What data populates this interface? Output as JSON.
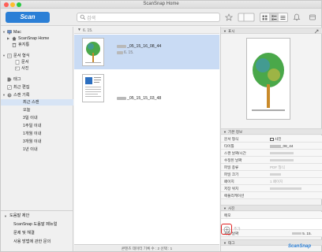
{
  "window": {
    "title": "ScanSnap Home"
  },
  "toolbar": {
    "scan_label": "Scan",
    "search_placeholder": "검색"
  },
  "sidebar": {
    "items": [
      {
        "label": "Mac",
        "level": 0,
        "icon": "computer-icon"
      },
      {
        "label": "ScanSnap Home",
        "level": 1,
        "icon": "home-icon"
      },
      {
        "label": "휴지통",
        "level": 1,
        "icon": "trash-icon"
      },
      {
        "label": "문서 형식",
        "level": 0,
        "icon": "document-type-icon"
      },
      {
        "label": "문서",
        "level": 1,
        "icon": "document-icon"
      },
      {
        "label": "사진",
        "level": 1,
        "icon": "photo-icon"
      },
      {
        "label": "태그",
        "level": 0,
        "icon": "tag-icon"
      },
      {
        "label": "최근 편집",
        "level": 0,
        "icon": "recent-edit-icon"
      },
      {
        "label": "스캔 기록",
        "level": 0,
        "icon": "scan-history-icon"
      },
      {
        "label": "최근 스캔",
        "level": 1,
        "icon": ""
      },
      {
        "label": "오늘",
        "level": 1,
        "icon": ""
      },
      {
        "label": "3일 이내",
        "level": 1,
        "icon": ""
      },
      {
        "label": "1주일 이내",
        "level": 1,
        "icon": ""
      },
      {
        "label": "1개월 이내",
        "level": 1,
        "icon": ""
      },
      {
        "label": "3개월 이내",
        "level": 1,
        "icon": ""
      },
      {
        "label": "1년 이내",
        "level": 1,
        "icon": ""
      }
    ],
    "help": {
      "header": "도움말 제안",
      "links": [
        "ScanSnap 도움말 페뉴얼",
        "문제 및 해결",
        "사용 방법에 관한 문의"
      ]
    }
  },
  "list": {
    "header": "6. 15.",
    "items": [
      {
        "name_suffix": "_05_15_16_08_44",
        "sub": "6. 15."
      },
      {
        "name_suffix": "_05_15_15_03_48",
        "sub": ""
      }
    ]
  },
  "status": {
    "text": "콘텐츠 데이터 기록 수 : 2 선택 : 1"
  },
  "detail": {
    "preview_header": "표시",
    "basic_header": "기본 정보",
    "props": [
      {
        "k": "문서 형식",
        "v": "사진",
        "dim": false
      },
      {
        "k": "타이틀",
        "v": "_08_44",
        "dim": false
      },
      {
        "k": "스캔 날짜/시간",
        "v": "",
        "dim": true
      },
      {
        "k": "수정된 날짜",
        "v": "",
        "dim": true
      },
      {
        "k": "파일 종류",
        "v": "PDF 형식",
        "dim": true
      },
      {
        "k": "파일 크기",
        "v": "",
        "dim": true
      },
      {
        "k": "페이지",
        "v": "1 페이지",
        "dim": true
      },
      {
        "k": "저장 위치",
        "v": "",
        "dim": true
      },
      {
        "k": "애플리케이션",
        "v": "",
        "dim": true
      }
    ],
    "doc_header": "사진",
    "doc_props": [
      {
        "k": "메모",
        "v": "",
        "dim": false
      },
      {
        "k": "사진 날짜",
        "v": "5. 15.",
        "dim": false
      }
    ],
    "tag_header": "태그",
    "tag_add_label": "추가"
  },
  "brand": "ScanSnap"
}
